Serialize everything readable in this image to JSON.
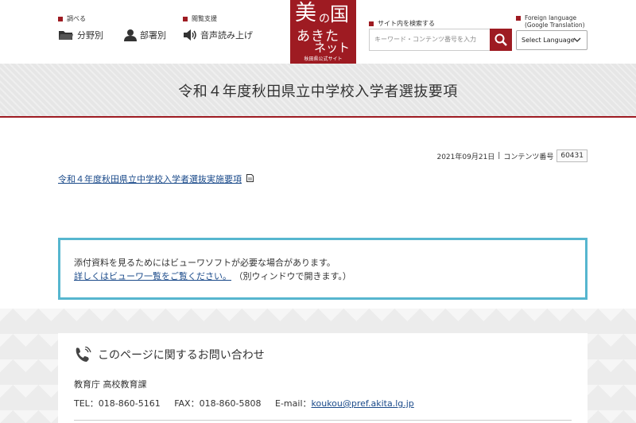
{
  "header": {
    "section_search": "調べる",
    "section_support": "閲覧支援",
    "nav_field": "分野別",
    "nav_dept": "部署別",
    "nav_voice": "音声読み上げ",
    "logo": {
      "line1a": "美",
      "line1b": "の",
      "line1c": "国",
      "line2": "あきた",
      "line3": "ネット",
      "line4": "秋田県公式サイト"
    },
    "search_label": "サイト内を検索する",
    "search_placeholder": "キーワード・コンテンツ番号を入力",
    "lang_label_1": "Foreign language",
    "lang_label_2": "(Google Translation)",
    "lang_select": "Select Language"
  },
  "page": {
    "title": "令和４年度秋田県立中学校入学者選抜要項",
    "date": "2021年09月21日",
    "content_no_label": "コンテンツ番号",
    "content_no": "60431",
    "doc_link": "令和４年度秋田県立中学校入学者選抜実施要項"
  },
  "notice": {
    "line1": "添付資料を見るためにはビューワソフトが必要な場合があります。",
    "link": "詳しくはビューワ一覧をご覧ください。",
    "link_suffix": "（別ウィンドウで開きます。）"
  },
  "contact": {
    "heading": "このページに関するお問い合わせ",
    "dept": "教育庁 高校教育課",
    "tel": "TEL：018-860-5161",
    "fax": "FAX：018-860-5808",
    "email_label": "E-mail：",
    "email": "koukou@pref.akita.lg.jp"
  },
  "colors": {
    "brand": "#9e1b22",
    "notice_border": "#56b6cf",
    "link": "#1a4a8a"
  }
}
